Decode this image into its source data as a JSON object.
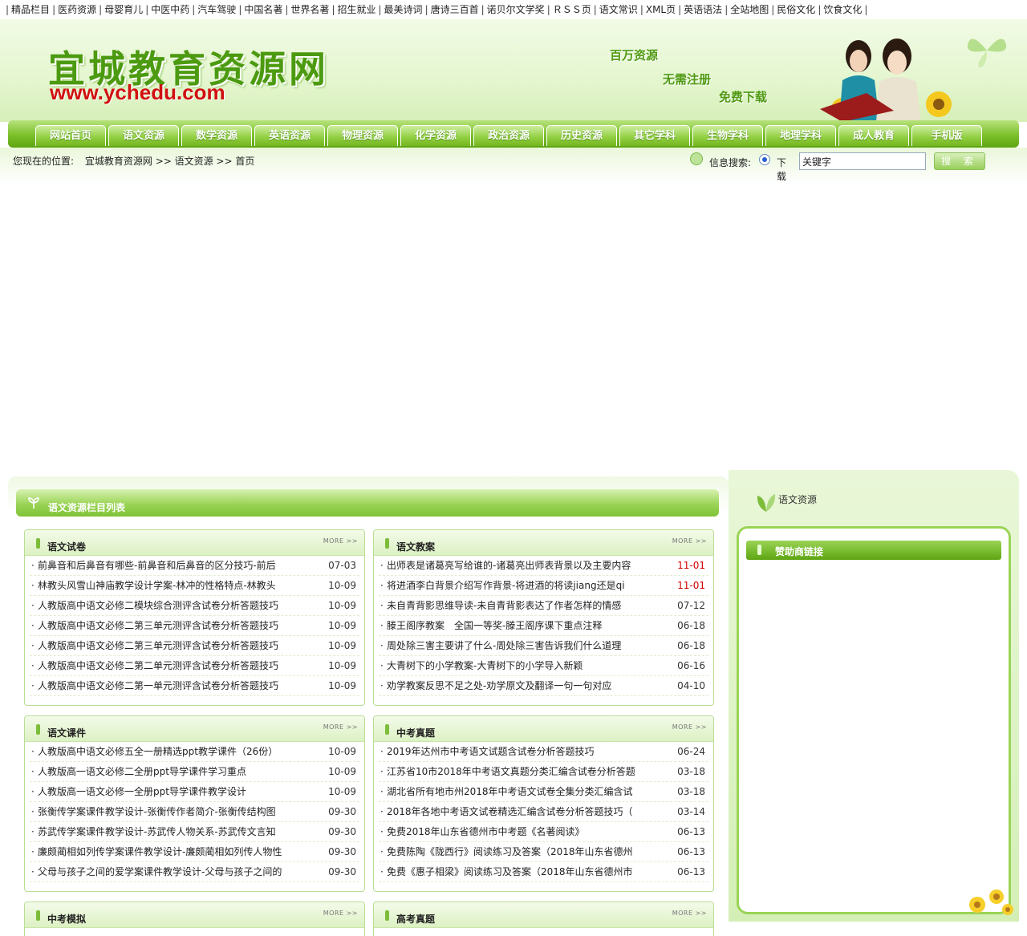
{
  "topbar": [
    "精品栏目",
    "医药资源",
    "母婴育儿",
    "中医中药",
    "汽车驾驶",
    "中国名著",
    "世界名著",
    "招生就业",
    "最美诗词",
    "唐诗三百首",
    "诺贝尔文学奖",
    "ＲＳＳ页",
    "语文常识",
    "XML页",
    "英语语法",
    "全站地图",
    "民俗文化",
    "饮食文化"
  ],
  "header": {
    "logo": "宜城教育资源网",
    "url": "www.ychedu.com",
    "slogans": [
      "百万资源",
      "无需注册",
      "免费下载"
    ]
  },
  "nav": [
    "网站首页",
    "语文资源",
    "数学资源",
    "英语资源",
    "物理资源",
    "化学资源",
    "政治资源",
    "历史资源",
    "其它学科",
    "生物学科",
    "地理学科",
    "成人教育",
    "手机版"
  ],
  "crumb": {
    "prefix": "您现在的位置:",
    "path": "宜城教育资源网 >> 语文资源 >> 首页"
  },
  "search": {
    "label": "信息搜索:",
    "option": "下载",
    "value": "关键字",
    "button": "搜 索"
  },
  "section_title": "语文资源栏目列表",
  "more": "MORE >>",
  "boxes": [
    {
      "title": "语文试卷",
      "items": [
        {
          "t": "前鼻音和后鼻音有哪些-前鼻音和后鼻音的区分技巧-前后",
          "d": "07-03"
        },
        {
          "t": "林教头风雪山神庙教学设计学案-林冲的性格特点-林教头",
          "d": "10-09"
        },
        {
          "t": "人教版高中语文必修二模块综合测评含试卷分析答题技巧",
          "d": "10-09"
        },
        {
          "t": "人教版高中语文必修二第三单元测评含试卷分析答题技巧",
          "d": "10-09"
        },
        {
          "t": "人教版高中语文必修二第三单元测评含试卷分析答题技巧",
          "d": "10-09"
        },
        {
          "t": "人教版高中语文必修二第二单元测评含试卷分析答题技巧",
          "d": "10-09"
        },
        {
          "t": "人教版高中语文必修二第一单元测评含试卷分析答题技巧",
          "d": "10-09"
        }
      ]
    },
    {
      "title": "语文教案",
      "items": [
        {
          "t": "出师表是诸葛亮写给谁的-诸葛亮出师表背景以及主要内容",
          "d": "11-01",
          "red": true
        },
        {
          "t": "将进酒李白背景介绍写作背景-将进酒的将读jiang还是qi",
          "d": "11-01",
          "red": true
        },
        {
          "t": "未自青背影思维导读-未自青背影表达了作者怎样的情感",
          "d": "07-12"
        },
        {
          "t": "滕王阁序教案　全国一等奖-滕王阁序课下重点注释",
          "d": "06-18"
        },
        {
          "t": "周处除三害主要讲了什么-周处除三害告诉我们什么道理",
          "d": "06-18"
        },
        {
          "t": "大青树下的小学教案-大青树下的小学导入新颖",
          "d": "06-16"
        },
        {
          "t": "劝学教案反思不足之处-劝学原文及翻译一句一句对应",
          "d": "04-10"
        }
      ]
    },
    {
      "title": "语文课件",
      "items": [
        {
          "t": "人教版高中语文必修五全一册精选ppt教学课件（26份）",
          "d": "10-09"
        },
        {
          "t": "人教版高一语文必修二全册ppt导学课件学习重点",
          "d": "10-09"
        },
        {
          "t": "人教版高一语文必修一全册ppt导学课件教学设计",
          "d": "10-09"
        },
        {
          "t": "张衡传学案课件教学设计-张衡传作者简介-张衡传结构图",
          "d": "09-30"
        },
        {
          "t": "苏武传学案课件教学设计-苏武传人物关系-苏武传文言知",
          "d": "09-30"
        },
        {
          "t": "廉颇蔺相如列传学案课件教学设计-廉颇蔺相如列传人物性",
          "d": "09-30"
        },
        {
          "t": "父母与孩子之间的爱学案课件教学设计-父母与孩子之间的",
          "d": "09-30"
        }
      ]
    },
    {
      "title": "中考真题",
      "items": [
        {
          "t": "2019年达州市中考语文试题含试卷分析答题技巧",
          "d": "06-24"
        },
        {
          "t": "江苏省10市2018年中考语文真题分类汇编含试卷分析答题",
          "d": "03-18"
        },
        {
          "t": "湖北省所有地市州2018年中考语文试卷全集分类汇编含试",
          "d": "03-18"
        },
        {
          "t": "2018年各地中考语文试卷精选汇编含试卷分析答题技巧（",
          "d": "03-14"
        },
        {
          "t": "免费2018年山东省德州市中考题《名著阅读》",
          "d": "06-13"
        },
        {
          "t": "免费陈陶《陇西行》阅读练习及答案（2018年山东省德州",
          "d": "06-13"
        },
        {
          "t": "免费《惠子相梁》阅读练习及答案（2018年山东省德州市",
          "d": "06-13"
        }
      ]
    },
    {
      "title": "中考模拟",
      "items": []
    },
    {
      "title": "高考真题",
      "items": []
    }
  ],
  "right": {
    "title": "语文资源",
    "sub": "赞助商链接"
  },
  "colors": {
    "accent": "#7bc02a",
    "date_red": "#d40000"
  }
}
